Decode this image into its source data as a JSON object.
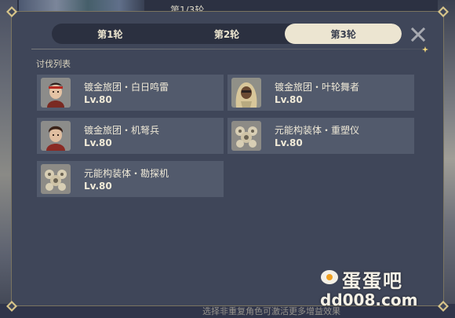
{
  "background": {
    "round_indicator": "第1/3轮",
    "footer_hint": "选择非重复角色可激活更多增益效果"
  },
  "tabs": [
    {
      "label": "第1轮",
      "active": false
    },
    {
      "label": "第2轮",
      "active": false
    },
    {
      "label": "第3轮",
      "active": true
    }
  ],
  "section_title": "讨伐列表",
  "enemies": [
    {
      "name": "镀金旅团・白日鸣雷",
      "level": "Lv.80",
      "portrait": "warrior-red-headband-icon"
    },
    {
      "name": "镀金旅团・叶轮舞者",
      "level": "Lv.80",
      "portrait": "blonde-dancer-icon"
    },
    {
      "name": "镀金旅团・机弩兵",
      "level": "Lv.80",
      "portrait": "crossbowman-icon"
    },
    {
      "name": "元能构装体・重塑仪",
      "level": "Lv.80",
      "portrait": "construct-icon"
    },
    {
      "name": "元能构装体・勘探机",
      "level": "Lv.80",
      "portrait": "construct-icon"
    }
  ],
  "watermark": {
    "logo": "蛋蛋吧",
    "url": "dd008.com"
  },
  "colors": {
    "panel": "#3f4659",
    "card": "#525a6c",
    "active_tab": "#ece5d1",
    "text": "#f0ead8"
  }
}
